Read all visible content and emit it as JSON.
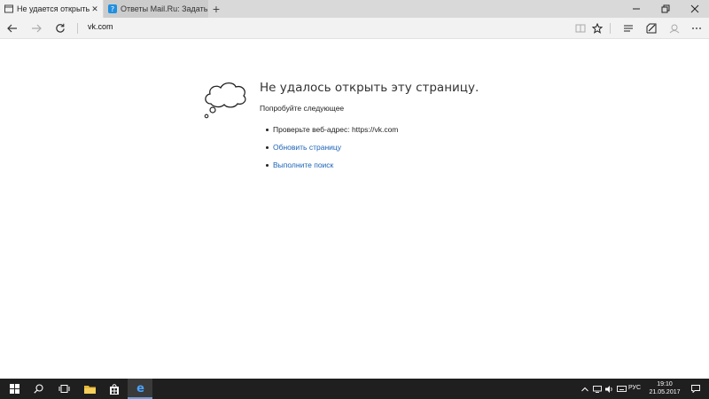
{
  "tabs": [
    {
      "title": "Не удается открыть эту",
      "active": true
    },
    {
      "title": "Ответы Mail.Ru: Задать воп",
      "active": false
    }
  ],
  "new_tab_label": "+",
  "address": {
    "url": "vk.com"
  },
  "error": {
    "title": "Не удалось открыть эту страницу.",
    "subtitle": "Попробуйте следующее",
    "items": [
      {
        "text": "Проверьте веб-адрес: https://vk.com"
      },
      {
        "text": "Обновить страницу"
      },
      {
        "text": "Выполните поиск"
      }
    ]
  },
  "taskbar": {
    "language": "РУС",
    "time": "19:10",
    "date": "21.05.2017"
  },
  "icons": {
    "tab1": "page-icon",
    "tab2": "mailru-icon",
    "back": "back-arrow-icon",
    "forward": "forward-arrow-icon",
    "refresh": "refresh-icon",
    "reading": "reading-view-icon",
    "favorite": "star-icon",
    "hub": "hub-icon",
    "note": "web-note-icon",
    "share": "share-icon",
    "more": "more-icon",
    "start": "windows-icon",
    "search": "search-icon",
    "taskview": "task-view-icon",
    "explorer": "folder-icon",
    "store": "store-icon",
    "edge": "edge-icon"
  },
  "colors": {
    "link": "#1a62b8",
    "taskbar": "#1f1f1f",
    "tabbar": "#d9d9d9",
    "toolbar": "#f2f2f2"
  }
}
